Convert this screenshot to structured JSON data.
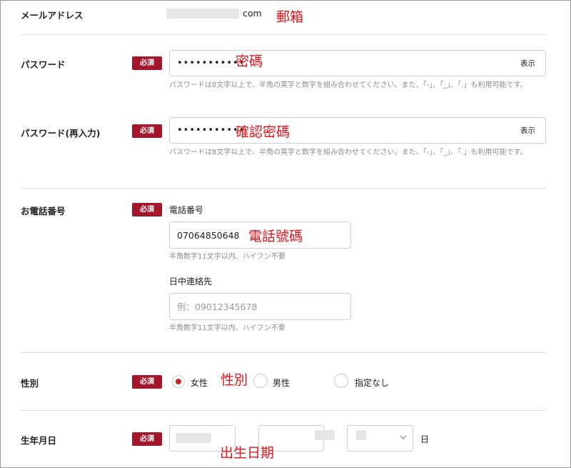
{
  "email": {
    "label": "メールアドレス",
    "value_suffix": "com",
    "overlay": "郵箱"
  },
  "password": {
    "label": "パスワード",
    "required": "必須",
    "value_masked": "•••••••••••",
    "show_label": "表示",
    "overlay": "密碼",
    "hint": "パスワードは8文字以上で、半角の英字と数字を組み合わせてください。また、「-」、「_」、「.」も利用可能です。"
  },
  "password_confirm": {
    "label": "パスワード(再入力)",
    "required": "必須",
    "value_masked": "•••••••••••",
    "show_label": "表示",
    "overlay": "確認密碼",
    "hint": "パスワードは8文字以上で、半角の英字と数字を組み合わせてください。また、「-」、「_」、「.」も利用可能です。"
  },
  "phone": {
    "label": "お電話番号",
    "required": "必須",
    "main_label": "電話番号",
    "main_value": "07064850648",
    "main_overlay": "電話號碼",
    "main_hint": "半角数字11文字以内、ハイフン不要",
    "day_label": "日中連絡先",
    "day_placeholder": "例：09012345678",
    "day_hint": "半角数字11文字以内、ハイフン不要"
  },
  "gender": {
    "label": "性別",
    "required": "必須",
    "overlay": "性別",
    "options": [
      {
        "label": "女性",
        "checked": true
      },
      {
        "label": "男性",
        "checked": false
      },
      {
        "label": "指定なし",
        "checked": false
      }
    ]
  },
  "birthday": {
    "label": "生年月日",
    "required": "必須",
    "day_suffix": "日",
    "overlay": "出生日期"
  },
  "colors": {
    "badge": "#a4162b",
    "overlay_text": "#e6121b",
    "radio_checked": "#c1272d"
  }
}
